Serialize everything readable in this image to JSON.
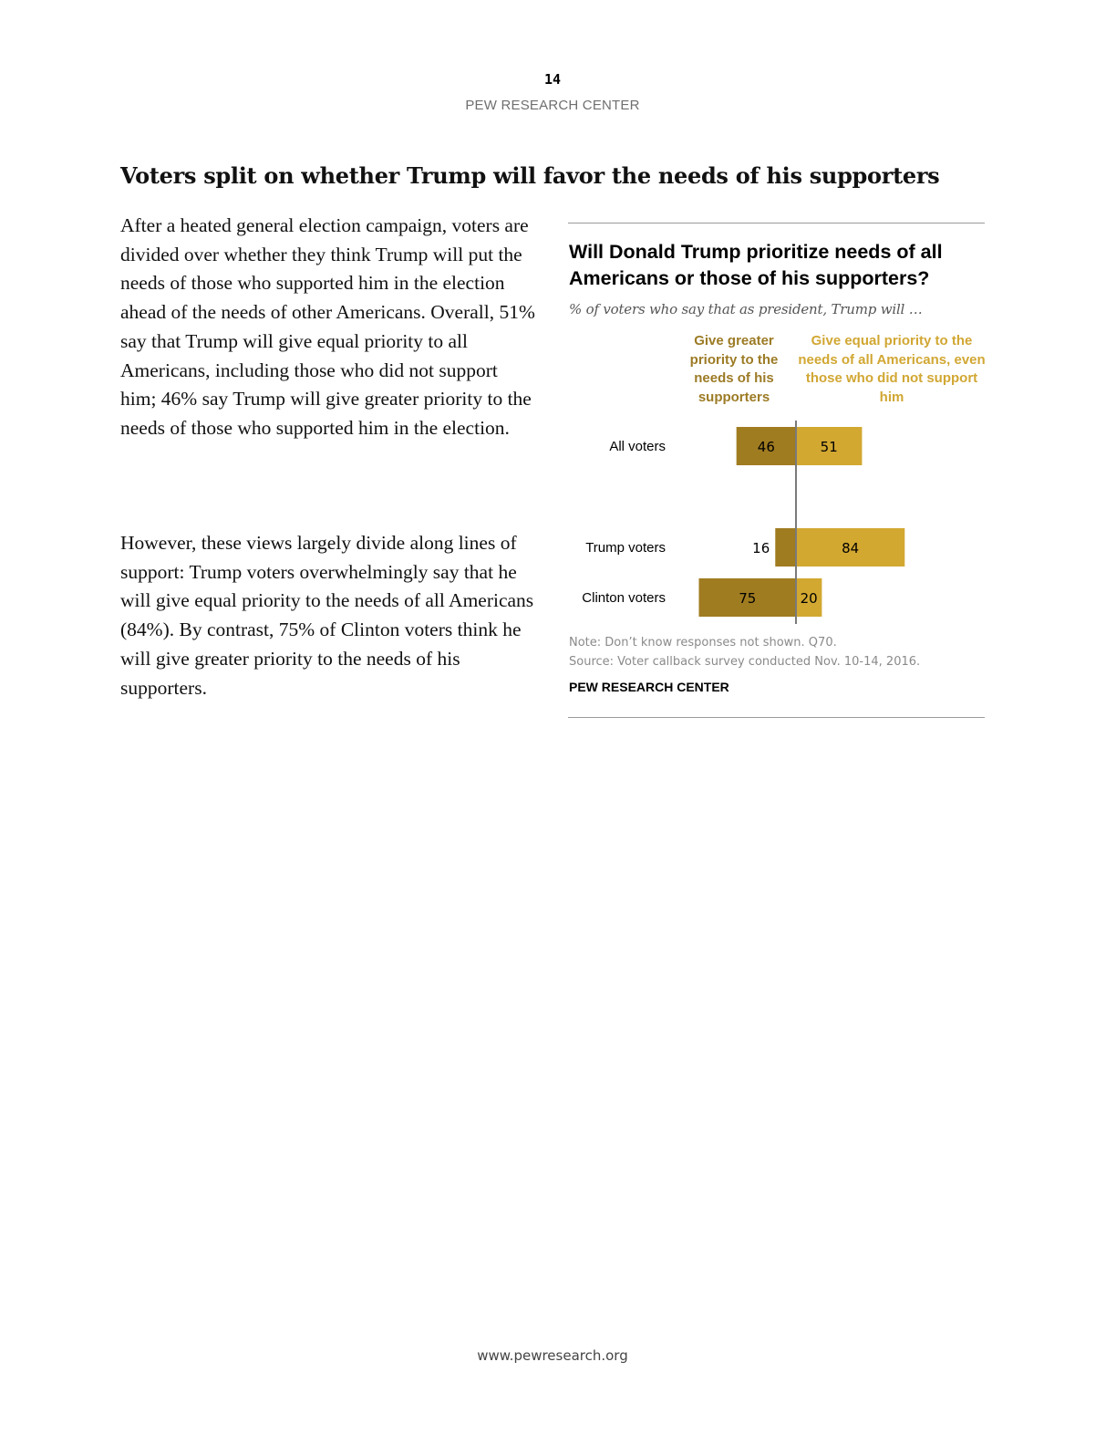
{
  "page": {
    "number": "14",
    "org": "PEW RESEARCH CENTER",
    "footer_url": "www.pewresearch.org"
  },
  "article": {
    "headline": "Voters split on whether Trump will favor the needs of his supporters",
    "paragraphs": [
      "After a heated general election campaign, voters are divided over whether they think Trump will put the needs of those who supported him in the election ahead of the needs of other Americans. Overall, 51% say that Trump will give equal priority to all Americans, including those who did not support him; 46% say Trump will give greater priority to the needs of those who supported him in the election.",
      "However, these views largely divide along lines of support: Trump voters overwhelmingly say that he will give equal priority to the needs of all Americans (84%). By contrast, 75% of Clinton voters think he will give greater priority to the needs of his supporters."
    ]
  },
  "chart_data": {
    "type": "bar",
    "orientation": "horizontal-diverging",
    "title": "Will Donald Trump prioritize needs of all Americans or those of his supporters?",
    "subtitle": "% of voters who say that as president, Trump will …",
    "categories": [
      "All voters",
      "Trump voters",
      "Clinton voters"
    ],
    "series": [
      {
        "name": "Give greater priority to the needs of his supporters",
        "values": [
          46,
          16,
          75
        ],
        "color": "#a07c21",
        "direction": "left"
      },
      {
        "name": "Give equal priority to the needs of all Americans, even those who did not support him",
        "values": [
          51,
          84,
          20
        ],
        "color": "#d2a831",
        "direction": "right"
      }
    ],
    "legend_placement": "top",
    "grid": false,
    "note": "Note: Don’t know responses not shown. Q70.",
    "source": "Source: Voter callback survey conducted Nov. 10-14, 2016.",
    "org": "PEW RESEARCH CENTER"
  }
}
